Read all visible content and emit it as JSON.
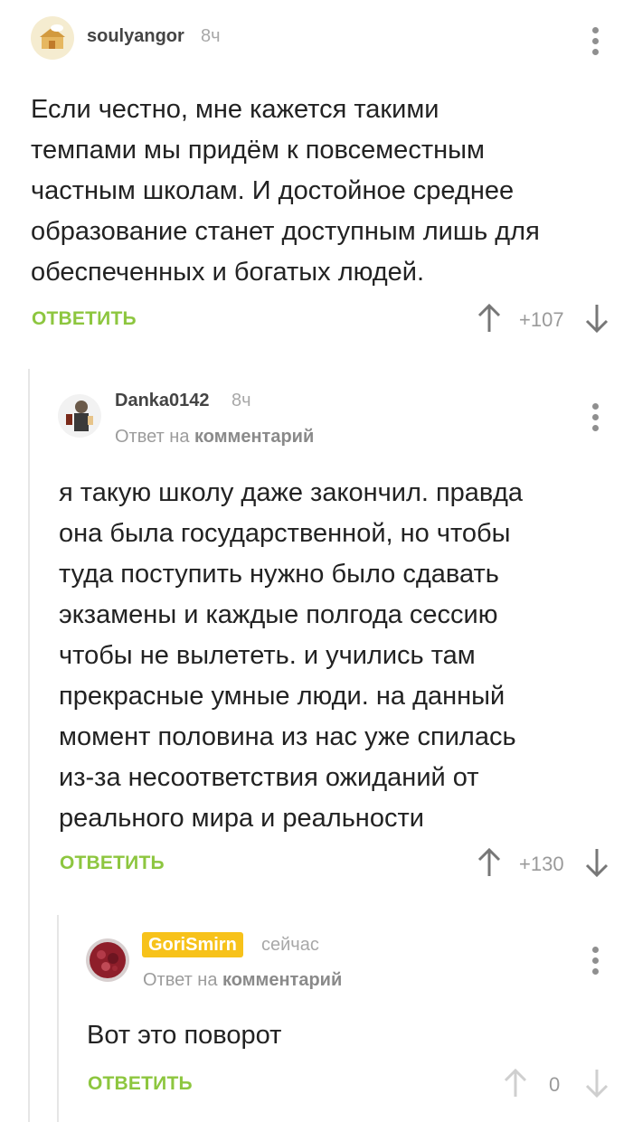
{
  "comments": [
    {
      "author": "soulyangor",
      "time": "8ч",
      "text_lines": [
        "Если честно, мне кажется такими",
        "темпами мы придём к повсеместным",
        "частным школам. И достойное среднее",
        "образование станет доступным лишь для",
        "обеспеченных и богатых людей."
      ],
      "reply_label": "ОТВЕТИТЬ",
      "score": "+107"
    },
    {
      "author": "Danka0142",
      "time": "8ч",
      "reply_to_prefix": "Ответ на",
      "reply_to_link": "комментарий",
      "text_lines": [
        "я такую школу даже закончил. правда",
        "она была государственной, но чтобы",
        "туда поступить нужно было сдавать",
        "экзамены и каждые полгода сессию",
        "чтобы не вылететь. и учились там",
        "прекрасные умные люди. на данный",
        "момент половина из нас уже спилась",
        "из-за несоответствия ожиданий от",
        "реального мира и реальности"
      ],
      "reply_label": "ОТВЕТИТЬ",
      "score": "+130"
    },
    {
      "author": "GoriSmirn",
      "time": "сейчас",
      "reply_to_prefix": "Ответ на",
      "reply_to_link": "комментарий",
      "text_lines": [
        "Вот это поворот"
      ],
      "reply_label": "ОТВЕТИТЬ",
      "score": "0"
    }
  ],
  "colors": {
    "accent": "#8dc63f",
    "badge": "#f7c21a",
    "thread_line": "#e6e6e6"
  },
  "icons": [
    "avatar",
    "kebab-menu-icon",
    "arrow-up-icon",
    "arrow-down-icon"
  ]
}
